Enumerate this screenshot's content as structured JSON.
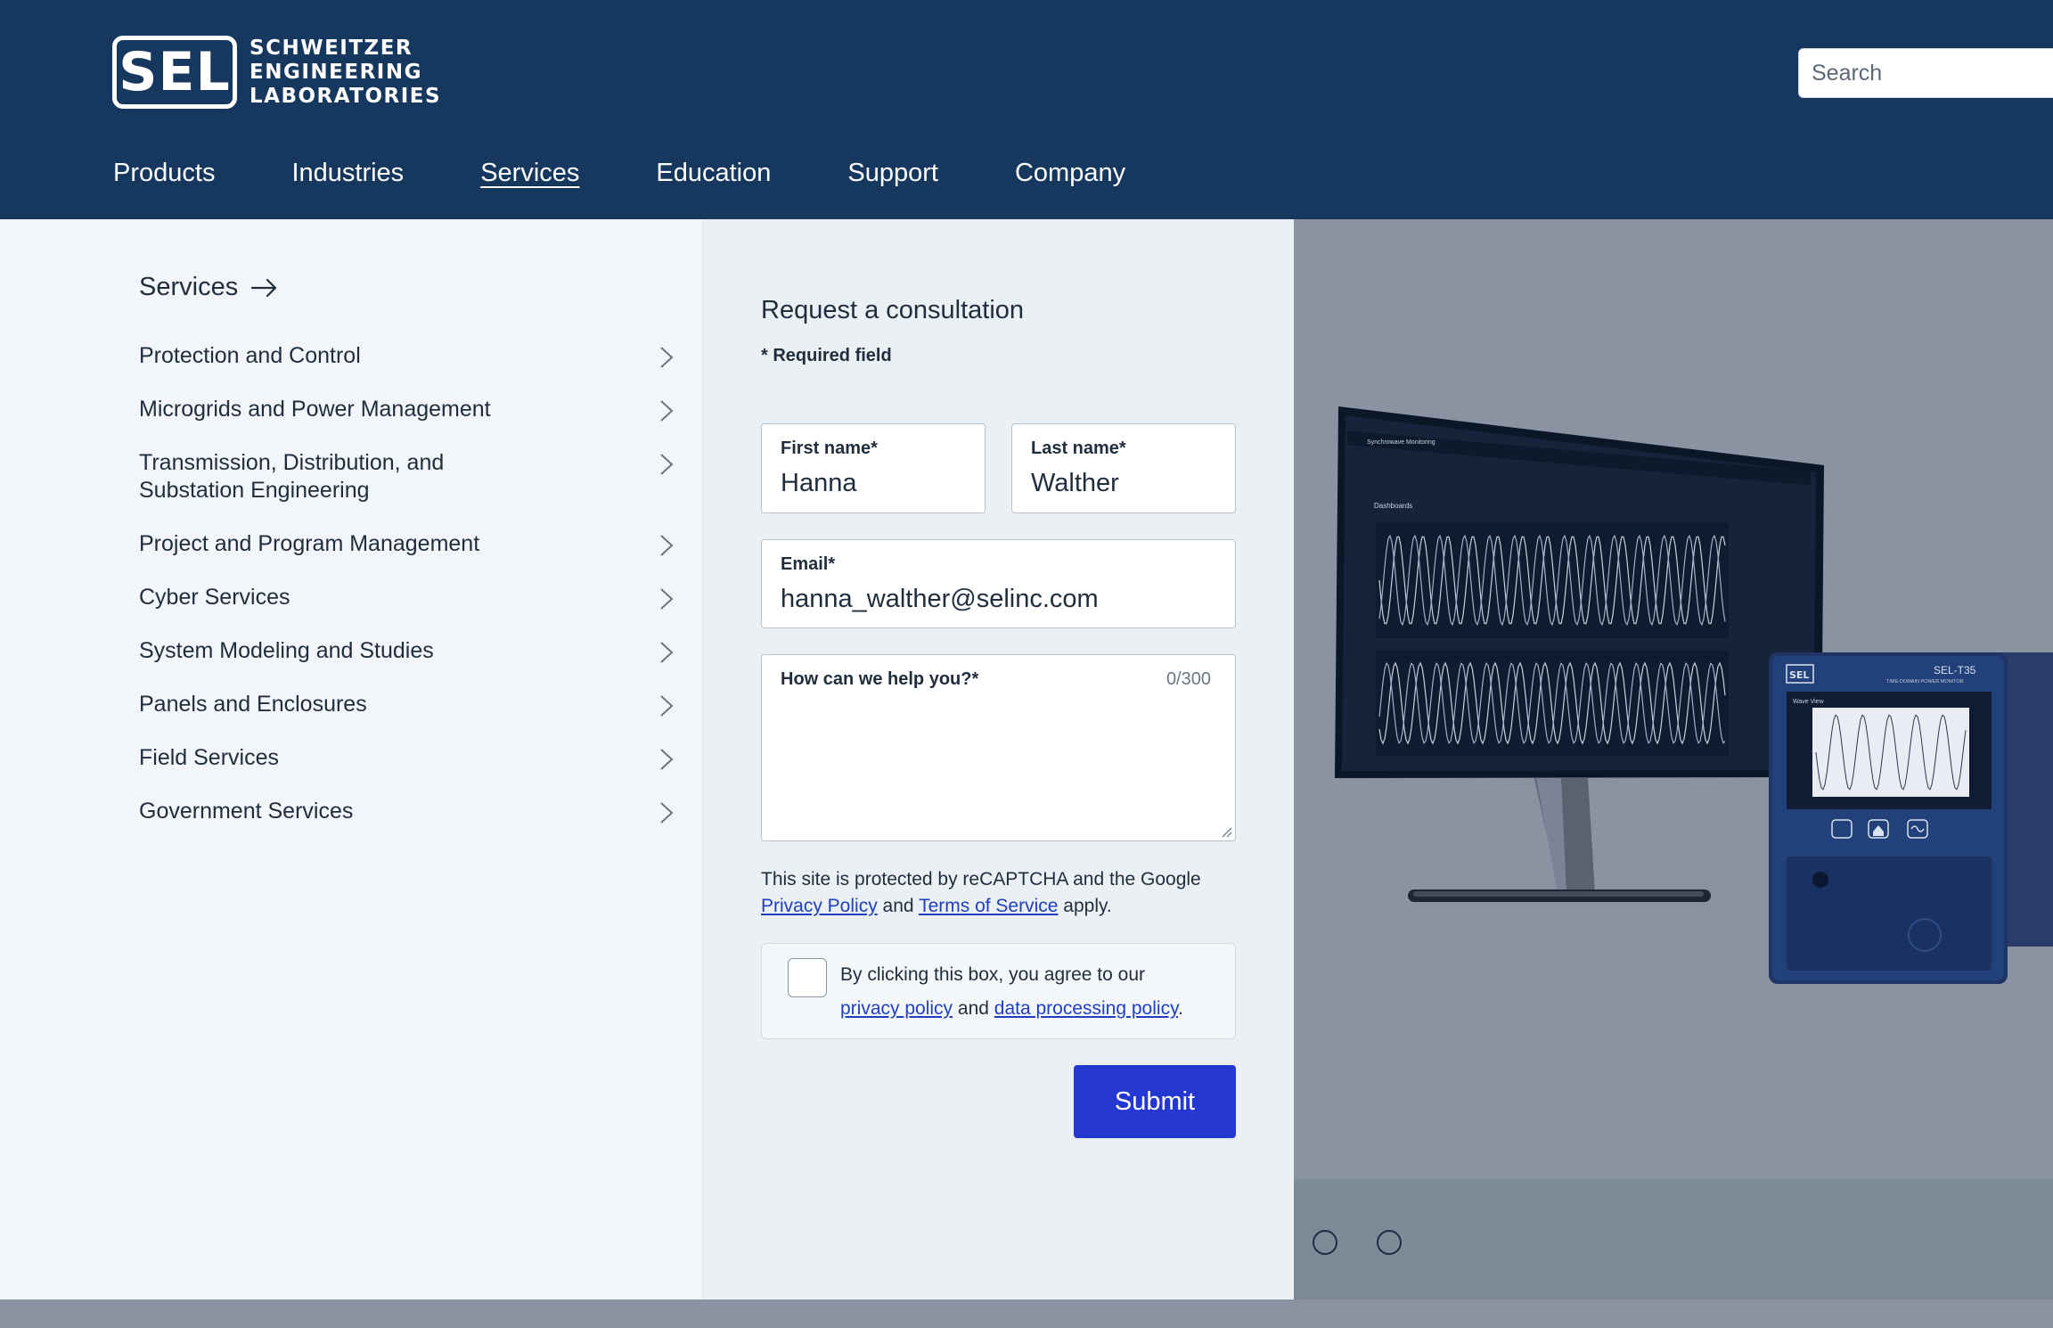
{
  "header": {
    "logo_mark": "SEL",
    "logo_lines": [
      "SCHWEITZER",
      "ENGINEERING",
      "LABORATORIES"
    ],
    "search_placeholder": "Search",
    "nav": [
      "Products",
      "Industries",
      "Services",
      "Education",
      "Support",
      "Company"
    ],
    "active_nav": "Services"
  },
  "menu": {
    "heading": "Services",
    "items": [
      "Protection and Control",
      "Microgrids and Power Management",
      "Transmission, Distribution, and Substation Engineering",
      "Project and Program Management",
      "Cyber Services",
      "System Modeling and Studies",
      "Panels and Enclosures",
      "Field Services",
      "Government Services"
    ]
  },
  "form": {
    "title": "Request a consultation",
    "required_note": "* Required field",
    "first_name_label": "First name*",
    "first_name_value": "Hanna",
    "last_name_label": "Last name*",
    "last_name_value": "Walther",
    "email_label": "Email*",
    "email_value": "hanna_walther@selinc.com",
    "help_label": "How can we help you?*",
    "help_count": "0/300",
    "recaptcha_text": "This site is protected by reCAPTCHA and the Google",
    "privacy_policy_link": "Privacy Policy",
    "and_text": "and",
    "terms_link": "Terms of Service",
    "apply_text": "apply.",
    "consent_text": "By clicking this box, you agree to our",
    "consent_privacy_link": "privacy policy",
    "consent_and": "and",
    "consent_dp_link": "data processing policy",
    "consent_period": ".",
    "submit_label": "Submit"
  },
  "product_image": {
    "monitor_title": "Synchrowave Monitoring",
    "monitor_section": "Dashboards",
    "device_brand": "SEL",
    "device_model": "SEL-T35",
    "device_subtitle": "TIME-DOMAIN POWER MONITOR",
    "device_screen_title": "Wave View",
    "carousel_dots": 2
  },
  "colors": {
    "header_bg": "#16385e",
    "submit_bg": "#2437d1",
    "link": "#1f3fbf"
  }
}
